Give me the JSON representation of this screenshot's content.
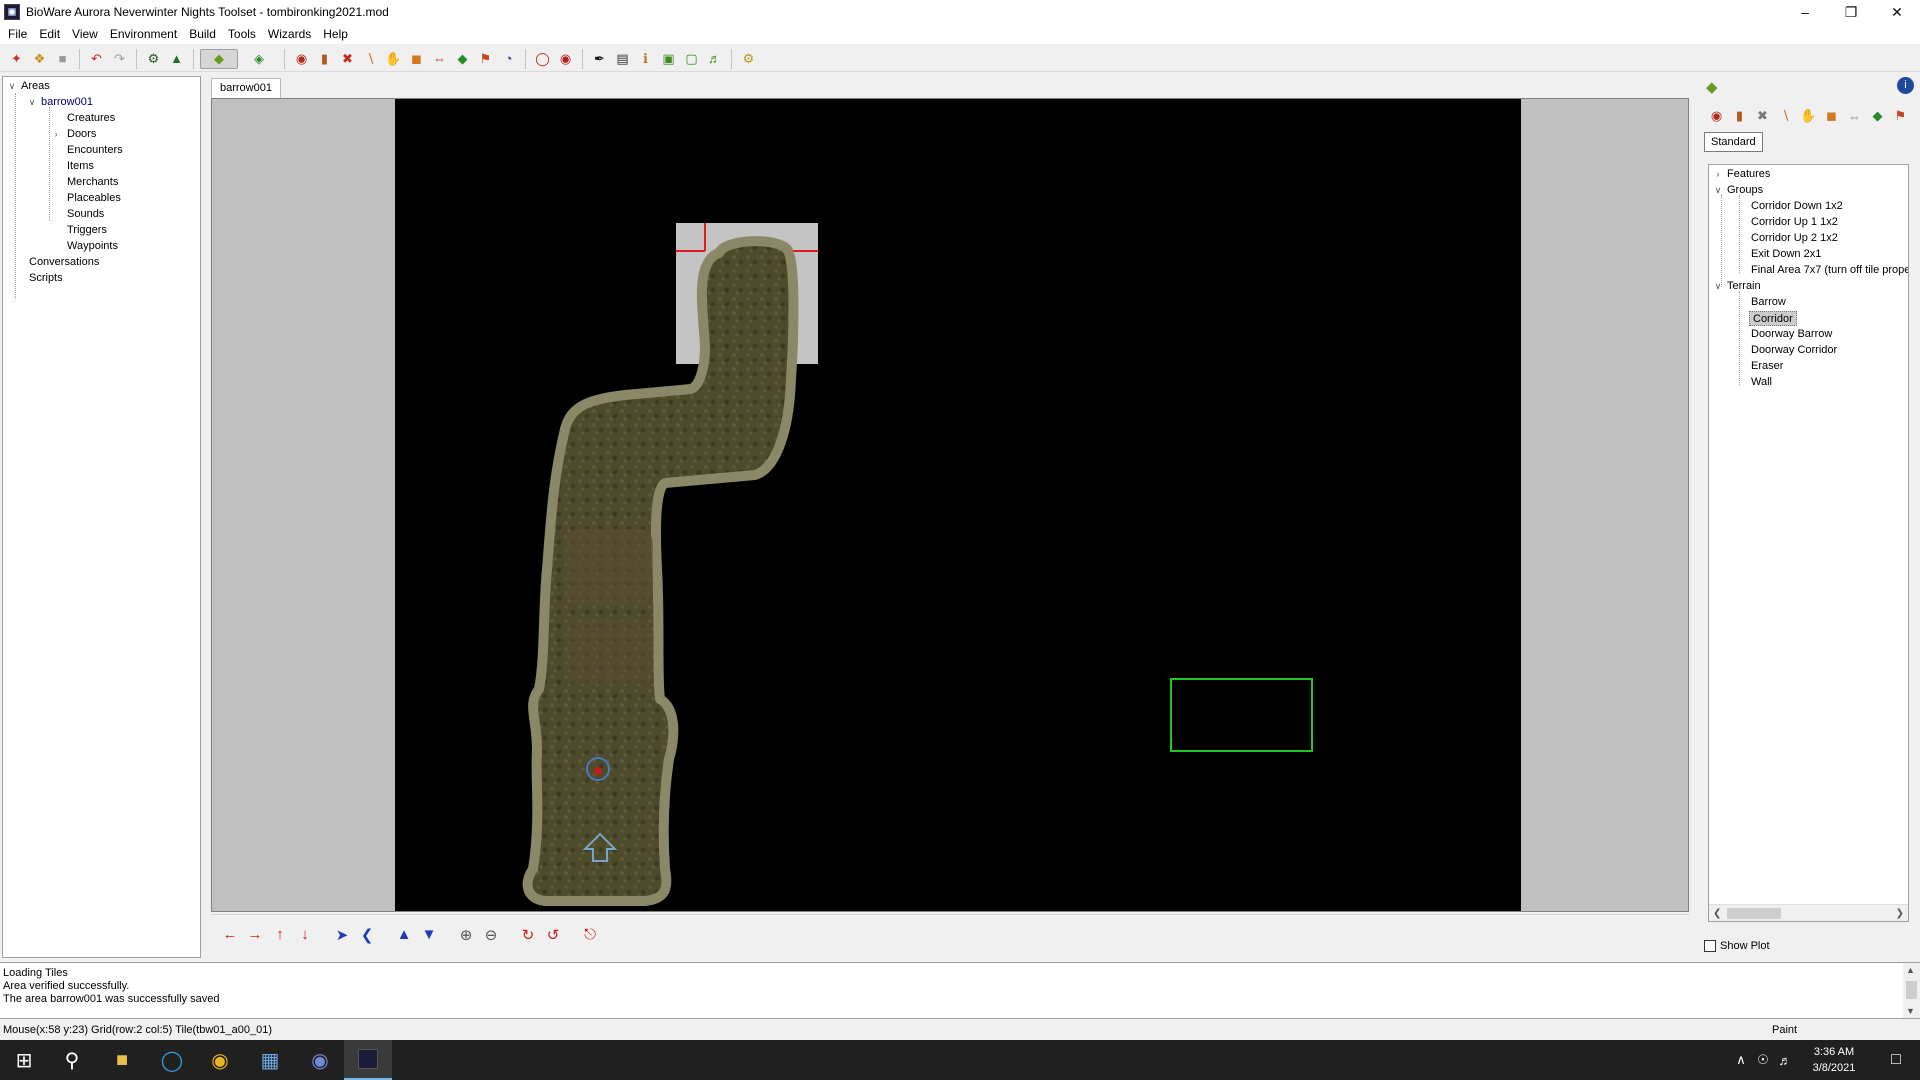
{
  "window": {
    "title": "BioWare Aurora Neverwinter Nights Toolset - tombironking2021.mod"
  },
  "menu": [
    "File",
    "Edit",
    "View",
    "Environment",
    "Build",
    "Tools",
    "Wizards",
    "Help"
  ],
  "toolbar_icons": [
    "new-module-icon",
    "open-module-icon",
    "save-icon",
    "undo-icon",
    "redo-icon",
    "module-properties-icon",
    "area-properties-icon",
    "paint-terrain-icon",
    "raise-lower-icon",
    "paint-creature-icon",
    "paint-door-icon",
    "paint-encounter-icon",
    "paint-item-icon",
    "paint-merchant-icon",
    "paint-placeable-icon",
    "paint-sound-icon",
    "paint-trigger-icon",
    "paint-waypoint-icon",
    "script-icon",
    "conversation-icon",
    "start-location-icon",
    "journal-icon",
    "plot-wizard-icon",
    "palette-icon",
    "custom-content-icon",
    "hak-pak-icon",
    "music-icon",
    "test-module-icon"
  ],
  "tree": {
    "root": "Areas",
    "area": "barrow001",
    "children": [
      "Creatures",
      "Doors",
      "Encounters",
      "Items",
      "Merchants",
      "Placeables",
      "Sounds",
      "Triggers",
      "Waypoints"
    ],
    "extra": [
      "Conversations",
      "Scripts"
    ]
  },
  "area_tab": "barrow001",
  "palette": {
    "tab": "Standard",
    "features_label": "Features",
    "groups_label": "Groups",
    "groups": [
      "Corridor Down 1x2",
      "Corridor Up 1 1x2",
      "Corridor Up 2 1x2",
      "Exit Down 2x1",
      "Final Area 7x7 (turn off tile proper"
    ],
    "terrain_label": "Terrain",
    "terrain": [
      "Barrow",
      "Corridor",
      "Doorway Barrow",
      "Doorway Corridor",
      "Eraser",
      "Wall"
    ],
    "selected": "Corridor"
  },
  "show_plot": "Show Plot",
  "log": [
    "Loading Tiles",
    "Area verified successfully.",
    "The area barrow001 was successfully saved"
  ],
  "status": {
    "coords": "Mouse(x:58 y:23) Grid(row:2 col:5) Tile(tbw01_a00_01)",
    "mode": "Paint"
  },
  "clock": {
    "time": "3:36 AM",
    "date": "3/8/2021"
  },
  "colors": {
    "selection_green": "#1ec81e",
    "cursor_red": "#e01c1c",
    "selected_item_bg": "#cccccc"
  }
}
